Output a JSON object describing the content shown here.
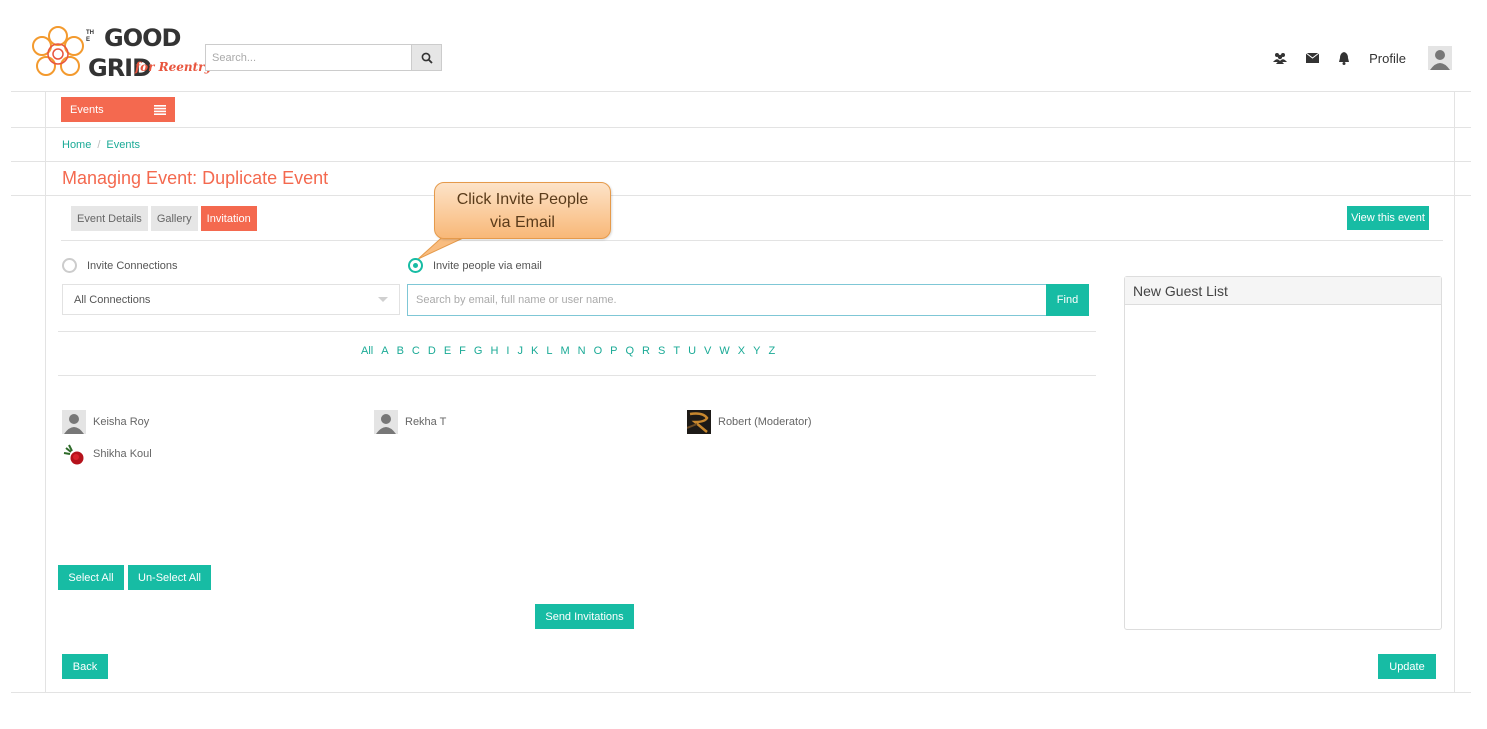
{
  "header": {
    "logo": {
      "line1": "THE",
      "line2": "GOOD",
      "line3": "GRID",
      "tagline": "for Reentry"
    },
    "search": {
      "placeholder": "Search...",
      "icon": "search-icon"
    },
    "icons": [
      "users-icon",
      "envelope-icon",
      "bell-icon"
    ],
    "profile_label": "Profile",
    "avatar_icon": "user-avatar-icon"
  },
  "nav": {
    "events_label": "Events",
    "events_icon": "list-icon"
  },
  "breadcrumb": {
    "items": [
      "Home",
      "Events"
    ]
  },
  "page": {
    "title": "Managing Event: Duplicate Event"
  },
  "tabs": [
    {
      "label": "Event Details",
      "active": false
    },
    {
      "label": "Gallery",
      "active": false
    },
    {
      "label": "Invitation",
      "active": true
    }
  ],
  "view_event_label": "View this event",
  "callout": {
    "line1": "Click Invite People",
    "line2": "via Email"
  },
  "invite": {
    "options": [
      {
        "label": "Invite Connections",
        "checked": false
      },
      {
        "label": "Invite people via email",
        "checked": true
      }
    ],
    "connections_select": "All Connections",
    "email_search_placeholder": "Search by email, full name or user name.",
    "find_label": "Find"
  },
  "alphabet": [
    "All",
    "A",
    "B",
    "C",
    "D",
    "E",
    "F",
    "G",
    "H",
    "I",
    "J",
    "K",
    "L",
    "M",
    "N",
    "O",
    "P",
    "Q",
    "R",
    "S",
    "T",
    "U",
    "V",
    "W",
    "X",
    "Y",
    "Z"
  ],
  "people": [
    {
      "name": "Keisha Roy",
      "avatar": "default-user-icon"
    },
    {
      "name": "Rekha T",
      "avatar": "default-user-icon"
    },
    {
      "name": "Robert (Moderator)",
      "avatar": "photo-avatar"
    },
    {
      "name": "Shikha Koul",
      "avatar": "rose-avatar"
    }
  ],
  "actions": {
    "select_all": "Select All",
    "unselect_all": "Un-Select All",
    "send_invitations": "Send Invitations",
    "back": "Back",
    "update": "Update"
  },
  "guest_list": {
    "title": "New Guest List"
  },
  "colors": {
    "accent_orange": "#f4694f",
    "accent_teal": "#17bca4",
    "link_teal": "#1aaa96"
  }
}
